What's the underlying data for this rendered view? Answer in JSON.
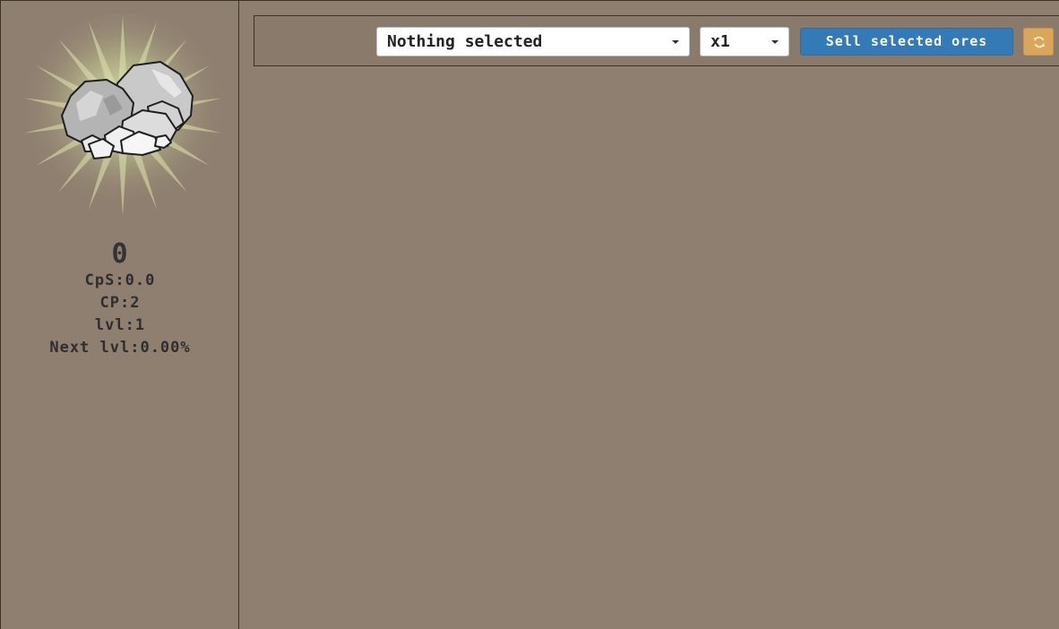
{
  "sidebar": {
    "rock_icon": "rock-pile-icon",
    "stats": {
      "count": "0",
      "cps": "CpS:0.0",
      "cp": "CP:2",
      "level": "lvl:1",
      "next_level": "Next lvl:0.00%"
    }
  },
  "toolbar": {
    "ore_select": {
      "selected": "Nothing selected"
    },
    "multiplier_select": {
      "selected": "x1"
    },
    "sell_button_label": "Sell selected ores",
    "refresh_icon": "refresh-icon"
  },
  "colors": {
    "background": "#8f7f70",
    "sell_button": "#337ab7",
    "refresh_button": "#d9a65c",
    "border": "#3a3128"
  }
}
